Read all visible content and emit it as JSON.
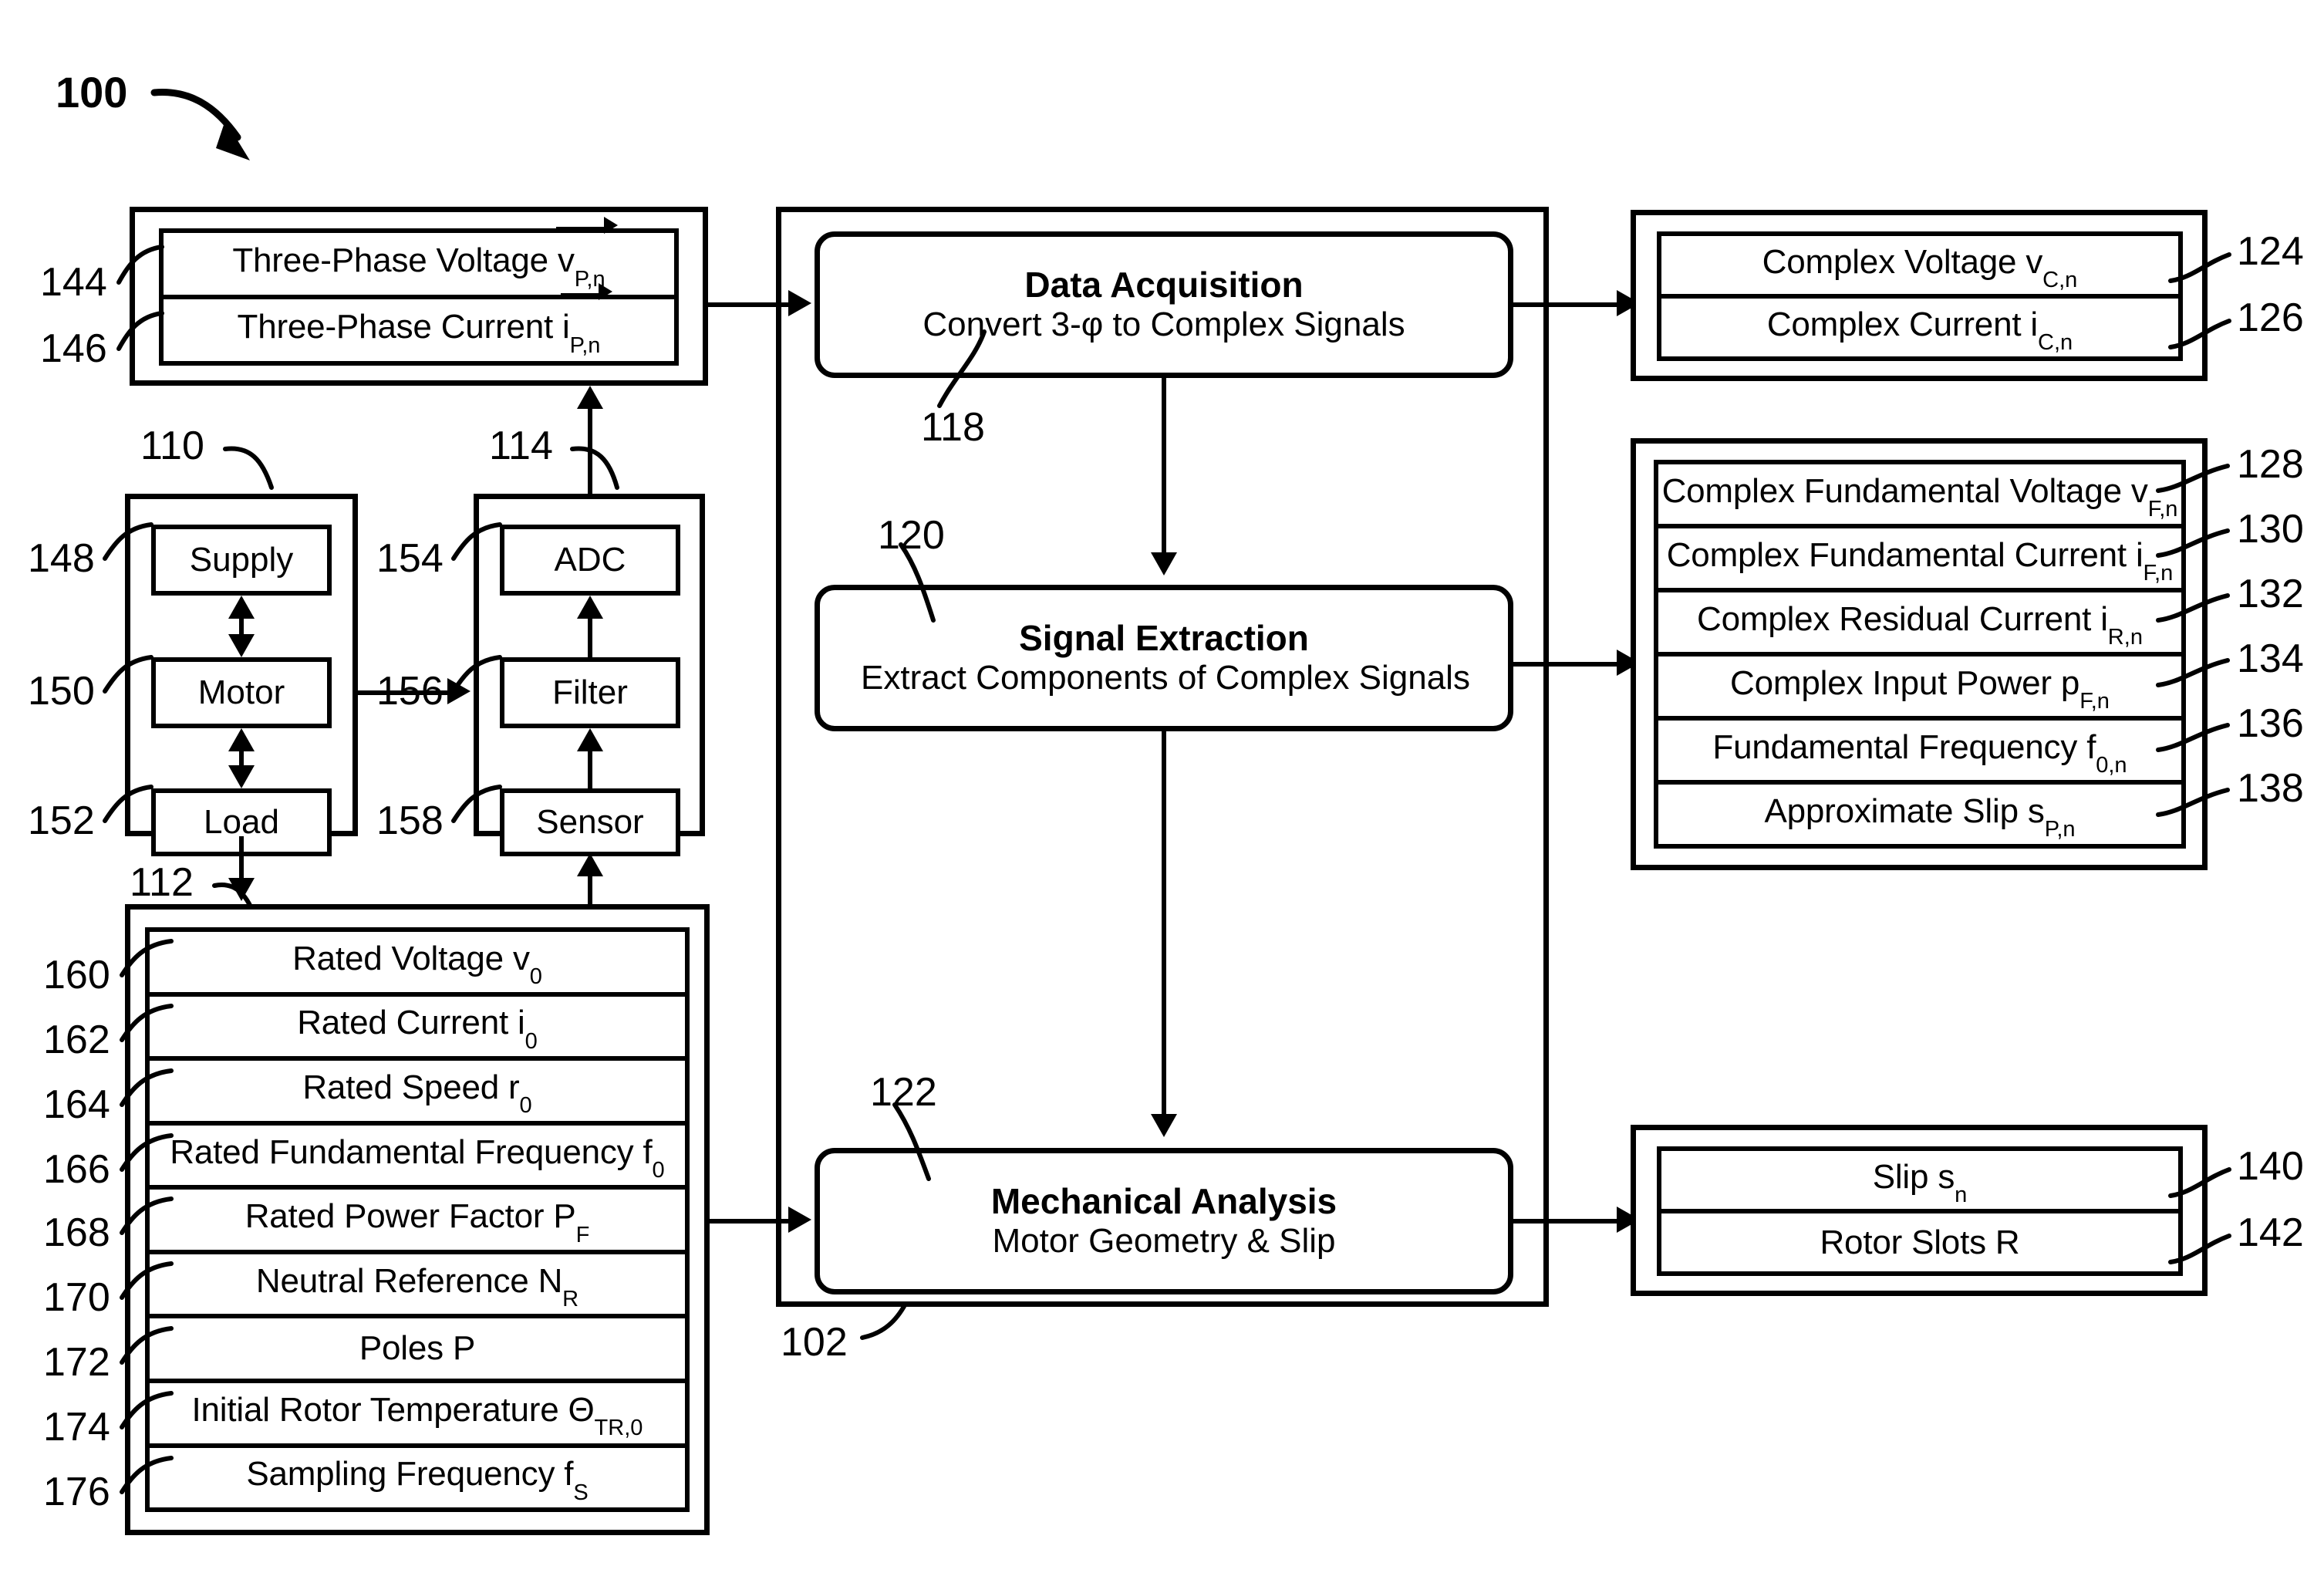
{
  "figure": {
    "number": "100",
    "system_ref": "102"
  },
  "input_signals": {
    "ref_box": "",
    "items": [
      {
        "ref": "144",
        "text_pre": "Three-Phase Voltage ",
        "sym": "v",
        "sub": "P,n",
        "overline_arrow": true
      },
      {
        "ref": "146",
        "text_pre": "Three-Phase Current ",
        "sym": "i",
        "sub": "P,n",
        "overline_arrow": true
      }
    ]
  },
  "motor_system": {
    "ref": "110",
    "items": [
      {
        "ref": "148",
        "label": "Supply"
      },
      {
        "ref": "150",
        "label": "Motor"
      },
      {
        "ref": "152",
        "label": "Load"
      }
    ]
  },
  "measurement_chain": {
    "ref": "114",
    "items": [
      {
        "ref": "154",
        "label": "ADC"
      },
      {
        "ref": "156",
        "label": "Filter"
      },
      {
        "ref": "158",
        "label": "Sensor"
      }
    ]
  },
  "rated_parameters": {
    "ref": "112",
    "items": [
      {
        "ref": "160",
        "text_pre": "Rated Voltage ",
        "sym": "v",
        "sub": "0"
      },
      {
        "ref": "162",
        "text_pre": "Rated Current ",
        "sym": "i",
        "sub": "0"
      },
      {
        "ref": "164",
        "text_pre": "Rated Speed ",
        "sym": "r",
        "sub": "0"
      },
      {
        "ref": "166",
        "text_pre": "Rated Fundamental Frequency ",
        "sym": "f",
        "sub": "0"
      },
      {
        "ref": "168",
        "text_pre": "Rated Power Factor ",
        "sym": "P",
        "sub": "F"
      },
      {
        "ref": "170",
        "text_pre": "Neutral Reference ",
        "sym": "N",
        "sub": "R"
      },
      {
        "ref": "172",
        "text_pre": "Poles P",
        "sym": "",
        "sub": ""
      },
      {
        "ref": "174",
        "text_pre": "Initial Rotor Temperature Θ",
        "sym": "",
        "sub": "TR,0"
      },
      {
        "ref": "176",
        "text_pre": "Sampling Frequency ",
        "sym": "f",
        "sub": "S"
      }
    ]
  },
  "processes": [
    {
      "ref": "118",
      "title": "Data Acquisition",
      "subtitle": "Convert 3-φ to Complex Signals"
    },
    {
      "ref": "120",
      "title": "Signal Extraction",
      "subtitle": "Extract Components of Complex Signals"
    },
    {
      "ref": "122",
      "title": "Mechanical Analysis",
      "subtitle": "Motor Geometry & Slip"
    }
  ],
  "outputs_complex": {
    "items": [
      {
        "ref": "124",
        "text_pre": "Complex Voltage ",
        "sym": "v",
        "sub": "C,n"
      },
      {
        "ref": "126",
        "text_pre": "Complex Current ",
        "sym": "i",
        "sub": "C,n"
      }
    ]
  },
  "outputs_components": {
    "items": [
      {
        "ref": "128",
        "text_pre": "Complex Fundamental Voltage ",
        "sym": "v",
        "sub": "F,n"
      },
      {
        "ref": "130",
        "text_pre": "Complex Fundamental Current ",
        "sym": "i",
        "sub": "F,n"
      },
      {
        "ref": "132",
        "text_pre": "Complex Residual Current ",
        "sym": "i",
        "sub": "R,n"
      },
      {
        "ref": "134",
        "text_pre": "Complex Input Power ",
        "sym": "p",
        "sub": "F,n"
      },
      {
        "ref": "136",
        "text_pre": "Fundamental Frequency ",
        "sym": "f",
        "sub": "0,n"
      },
      {
        "ref": "138",
        "text_pre": "Approximate Slip ",
        "sym": "s",
        "sub": "P,n"
      }
    ]
  },
  "outputs_mechanical": {
    "items": [
      {
        "ref": "140",
        "text_pre": "Slip ",
        "sym": "s",
        "sub": "n"
      },
      {
        "ref": "142",
        "text_pre": "Rotor Slots R",
        "sym": "",
        "sub": ""
      }
    ]
  },
  "colors": {
    "line": "#000000",
    "background": "#ffffff"
  }
}
